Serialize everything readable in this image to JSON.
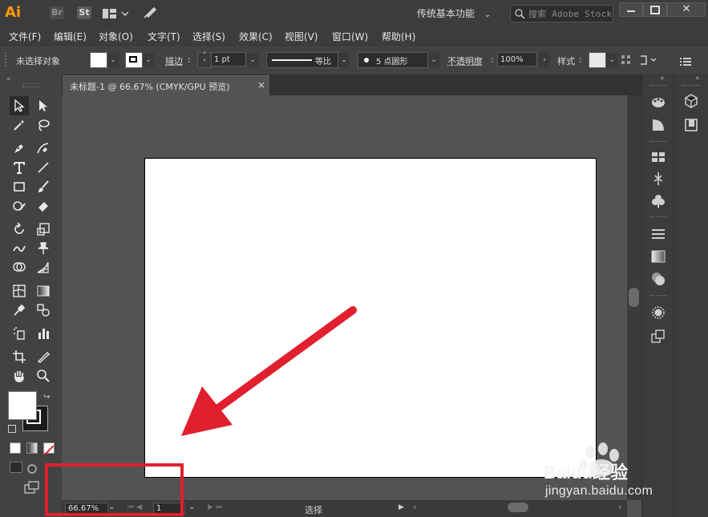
{
  "app": {
    "logo": "Ai",
    "bridge_badge": "Br",
    "stock_badge": "St",
    "workspace": "传统基本功能",
    "search_placeholder": "搜索 Adobe Stock"
  },
  "menu": [
    "文件(F)",
    "编辑(E)",
    "对象(O)",
    "文字(T)",
    "选择(S)",
    "效果(C)",
    "视图(V)",
    "窗口(W)",
    "帮助(H)"
  ],
  "control": {
    "selection_status": "未选择对象",
    "stroke_label": "描边",
    "stroke_weight": "1 pt",
    "profile_label": "等比",
    "brush_label": "5 点圆形",
    "opacity_label": "不透明度",
    "opacity_value": "100%",
    "style_label": "样式"
  },
  "document": {
    "tab_title": "未标题-1 @ 66.67% (CMYK/GPU 预览)",
    "close_glyph": "×"
  },
  "status": {
    "zoom": "66.67%",
    "page": "1",
    "tool_state": "选择"
  },
  "watermark": {
    "brand": "Baidu经验",
    "url": "jingyan.baidu.com"
  },
  "colors": {
    "annotation_red": "#e0202e",
    "ai_orange": "#ff9a00",
    "ui_dark": "#424242",
    "canvas_gray": "#535353"
  }
}
